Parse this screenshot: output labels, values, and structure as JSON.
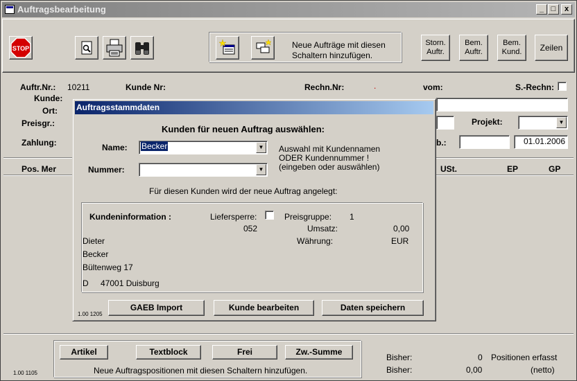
{
  "window": {
    "title": "Auftragsbearbeitung",
    "min_label": "_",
    "max_label": "□",
    "close_label": "x"
  },
  "toolbar": {
    "stop_label": "STOP",
    "add_hint_line1": "Neue Aufträge mit diesen",
    "add_hint_line2": "Schaltern hinzufügen.",
    "storn_line1": "Storn.",
    "storn_line2": "Auftr.",
    "bem_auftr_line1": "Bem.",
    "bem_auftr_line2": "Auftr.",
    "bem_kund_line1": "Bem.",
    "bem_kund_line2": "Kund.",
    "zeilen_label": "Zeilen"
  },
  "header": {
    "auftr_nr_label": "Auftr.Nr.:",
    "auftr_nr_value": "10211",
    "kunde_nr_label": "Kunde Nr:",
    "rechn_nr_label": "Rechn.Nr:",
    "rechn_nr_value": ".",
    "vom_label": "vom:",
    "s_rechn_label": "S.-Rechn:",
    "kunde_label": "Kunde:",
    "ort_label": "Ort:",
    "preisgr_label": "Preisgr.:",
    "projekt_label": "Projekt:",
    "zahlung_label": "Zahlung:",
    "lb_label": "b.:",
    "date_value": "01.01.2006"
  },
  "positions_header": {
    "pos_label": "Pos. Mer",
    "ust_label": "USt.",
    "ep_label": "EP",
    "gp_label": "GP"
  },
  "dialog": {
    "title": "Auftragsstammdaten",
    "heading": "Kunden für neuen Auftrag auswählen:",
    "name_label": "Name:",
    "name_value": "Becker",
    "nummer_label": "Nummer:",
    "nummer_value": "",
    "hint_line1": "Auswahl mit Kundennamen",
    "hint_line2": "ODER Kundennummer !",
    "hint_line3": "(eingeben oder auswählen)",
    "info_text": "Für diesen Kunden wird der neue Auftrag angelegt:",
    "kundeninfo_label": "Kundeninformation :",
    "liefersperre_label": "Liefersperre:",
    "preisgruppe_label": "Preisgruppe:",
    "preisgruppe_value": "1",
    "code_value": "052",
    "umsatz_label": "Umsatz:",
    "umsatz_value": "0,00",
    "waehrung_label": "Währung:",
    "waehrung_value": "EUR",
    "vorname": "Dieter",
    "nachname": "Becker",
    "strasse": "Bültenweg 17",
    "land": "D",
    "plz_ort": "47001 Duisburg",
    "gaeb_button": "GAEB Import",
    "kunde_bearbeiten_button": "Kunde bearbeiten",
    "daten_speichern_button": "Daten speichern",
    "version": "1.00 1205"
  },
  "footer": {
    "artikel_button": "Artikel",
    "textblock_button": "Textblock",
    "frei_button": "Frei",
    "zwsumme_button": "Zw.-Summe",
    "hint": "Neue Auftragspositionen mit diesen Schaltern hinzufügen.",
    "bisher1_label": "Bisher:",
    "bisher1_value": "0",
    "positionen_label": "Positionen erfasst",
    "bisher2_label": "Bisher:",
    "bisher2_value": "0,00",
    "netto_label": "(netto)",
    "version": "1.00 1105"
  },
  "colors": {
    "titlebar_inactive": "#808080",
    "dialog_title_active": "#0a246a",
    "stop_red": "#d40000",
    "face": "#d4d0c8"
  }
}
